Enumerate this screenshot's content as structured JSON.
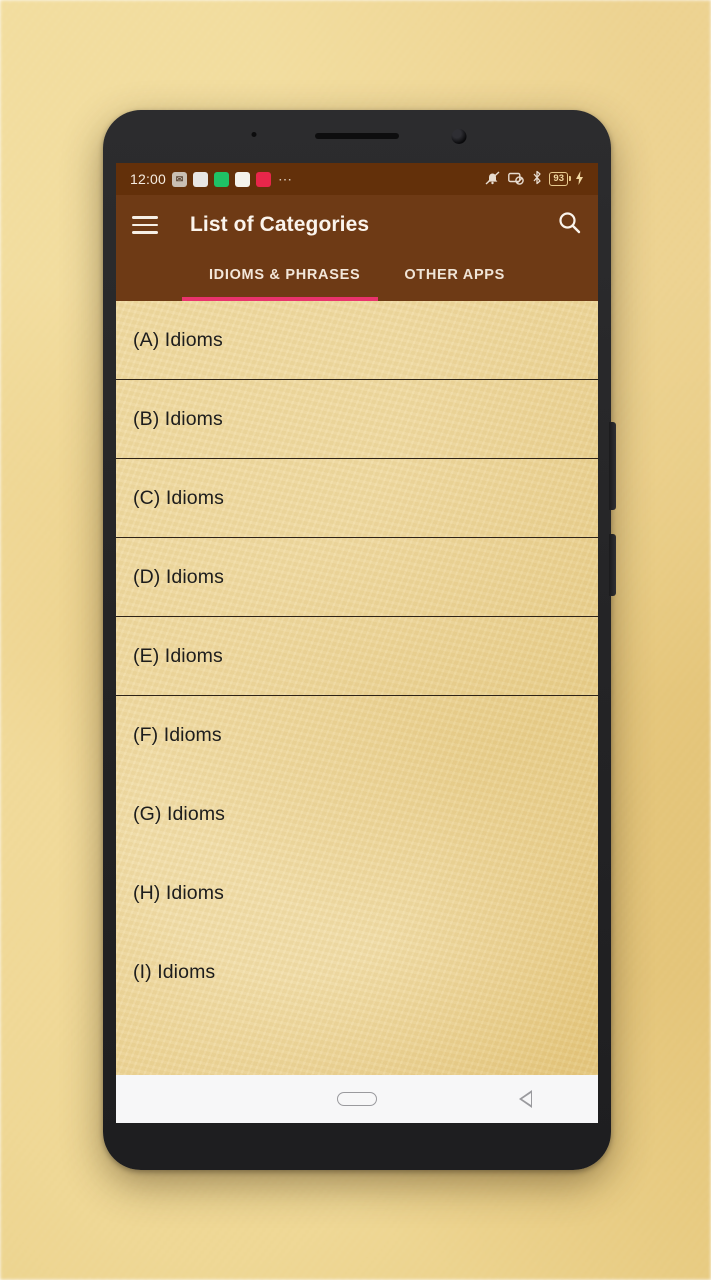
{
  "statusbar": {
    "time": "12:00",
    "battery_level": "93",
    "icons_left": [
      "sms-icon",
      "notes-icon",
      "chat-icon",
      "photos-icon",
      "video-icon",
      "overflow-dots"
    ],
    "overflow": "⋯",
    "icons_right": [
      "mute-icon",
      "screenshot-blocked-icon",
      "bluetooth-icon",
      "battery-icon",
      "charging-bolt-icon"
    ],
    "bluetooth_glyph": "ʙ"
  },
  "appbar": {
    "menu_label": "menu-icon",
    "title": "List of Categories",
    "search_label": "search-icon"
  },
  "tabs": {
    "items": [
      {
        "label": "IDIOMS & PHRASES",
        "active": true
      },
      {
        "label": "OTHER APPS",
        "active": false
      }
    ],
    "indicator_color": "#e8336d"
  },
  "list": {
    "items": [
      {
        "label": "(A) Idioms",
        "divider": true
      },
      {
        "label": "(B) Idioms",
        "divider": true
      },
      {
        "label": "(C) Idioms",
        "divider": true
      },
      {
        "label": "(D) Idioms",
        "divider": true
      },
      {
        "label": "(E) Idioms",
        "divider": true
      },
      {
        "label": "(F) Idioms",
        "divider": false
      },
      {
        "label": "(G) Idioms",
        "divider": false
      },
      {
        "label": "(H) Idioms",
        "divider": false
      },
      {
        "label": "(I) Idioms",
        "divider": false
      }
    ]
  },
  "navbar": {
    "home_label": "home-button",
    "back_label": "back-button"
  },
  "colors": {
    "statusbar_bg": "#63300a",
    "appbar_bg": "#6e3a15",
    "accent": "#e8336d",
    "paper": "#ecd291",
    "text": "#1d1d1d"
  }
}
